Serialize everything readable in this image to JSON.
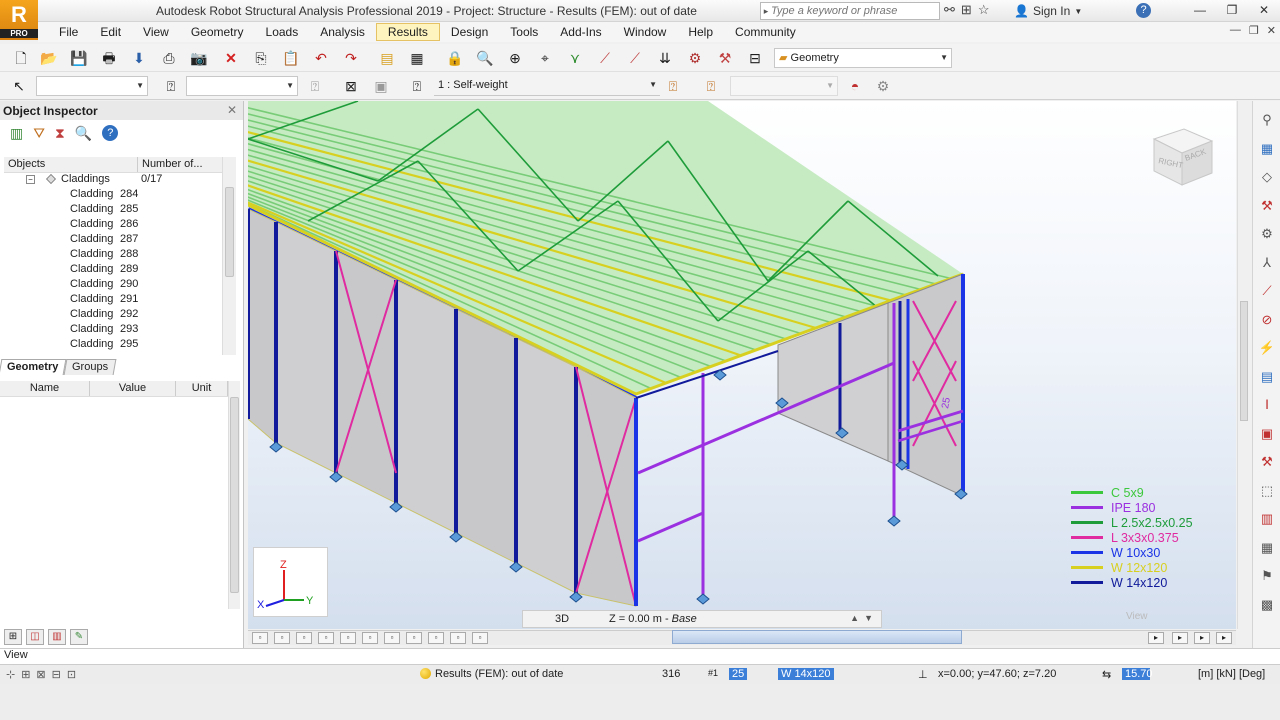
{
  "window": {
    "title": "Autodesk Robot Structural Analysis Professional 2019 - Project: Structure - Results (FEM): out of date",
    "logo_letter": "R",
    "logo_badge": "PRO",
    "search_placeholder": "Type a keyword or phrase",
    "signin": "Sign In"
  },
  "menu": [
    {
      "label": "File"
    },
    {
      "label": "Edit"
    },
    {
      "label": "View"
    },
    {
      "label": "Geometry"
    },
    {
      "label": "Loads"
    },
    {
      "label": "Analysis"
    },
    {
      "label": "Results",
      "active": true
    },
    {
      "label": "Design"
    },
    {
      "label": "Tools"
    },
    {
      "label": "Add-Ins"
    },
    {
      "label": "Window"
    },
    {
      "label": "Help"
    },
    {
      "label": "Community"
    }
  ],
  "toolbar": {
    "layout_combo": "Geometry",
    "load_case_combo": "1 : Self-weight"
  },
  "inspector": {
    "title": "Object Inspector",
    "col_objects": "Objects",
    "col_number": "Number of...",
    "root": {
      "label": "Claddings",
      "count": "0/17"
    },
    "items": [
      {
        "label": "Cladding",
        "num": "284"
      },
      {
        "label": "Cladding",
        "num": "285"
      },
      {
        "label": "Cladding",
        "num": "286"
      },
      {
        "label": "Cladding",
        "num": "287"
      },
      {
        "label": "Cladding",
        "num": "288"
      },
      {
        "label": "Cladding",
        "num": "289"
      },
      {
        "label": "Cladding",
        "num": "290"
      },
      {
        "label": "Cladding",
        "num": "291"
      },
      {
        "label": "Cladding",
        "num": "292"
      },
      {
        "label": "Cladding",
        "num": "293"
      },
      {
        "label": "Cladding",
        "num": "295"
      }
    ],
    "tab_geometry": "Geometry",
    "tab_groups": "Groups",
    "prop_name": "Name",
    "prop_value": "Value",
    "prop_unit": "Unit"
  },
  "viewport": {
    "mode": "3D",
    "level": "Z = 0.00 m - ",
    "level_name": "Base",
    "view_label": "View",
    "cube_right": "RIGHT",
    "cube_back": "BACK",
    "member_label": "25",
    "axis_z": "Z",
    "axis_x": "X",
    "axis_y": "Y"
  },
  "legend": [
    {
      "label": "C 5x9",
      "color": "#3cc83c"
    },
    {
      "label": "IPE 180",
      "color": "#9b30e0"
    },
    {
      "label": "L 2.5x2.5x0.25",
      "color": "#1e9c3a"
    },
    {
      "label": "L 3x3x0.375",
      "color": "#e02aa0"
    },
    {
      "label": "W 10x30",
      "color": "#1a34e6"
    },
    {
      "label": "W 12x120",
      "color": "#d8d020"
    },
    {
      "label": "W 14x120",
      "color": "#101a9a"
    }
  ],
  "statusbar": {
    "cmd_text": "View",
    "results_status": "Results (FEM): out of date",
    "count": "316",
    "member_num": "25",
    "section": "W 14x120",
    "coords": "x=0.00; y=47.60; z=7.20",
    "value_box": "15.70",
    "units": "[m] [kN] [Deg]"
  }
}
